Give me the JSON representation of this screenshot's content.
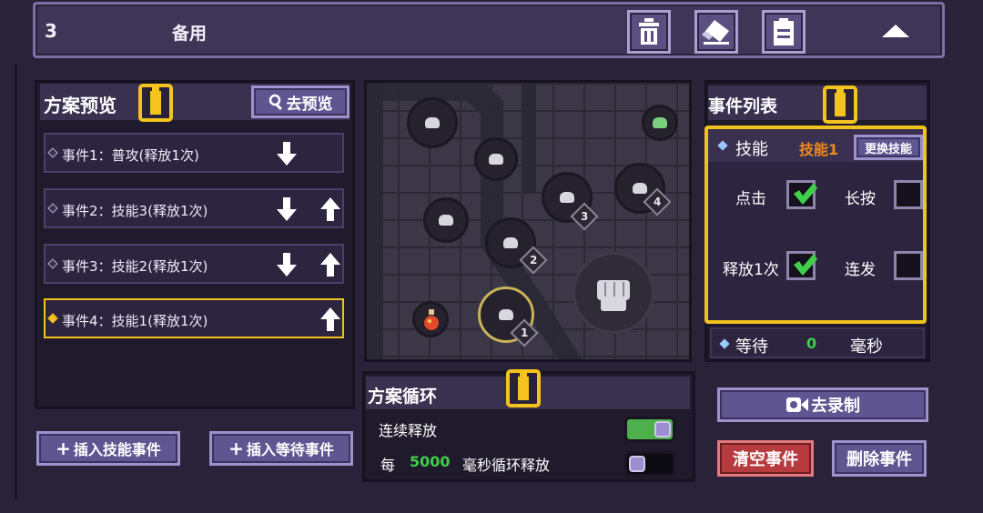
{
  "header": {
    "slot_number": "3",
    "slot_name": "备用"
  },
  "preview": {
    "title": "方案预览",
    "go_preview_label": "去预览",
    "events": [
      {
        "label": "事件1：普攻(释放1次)",
        "down": true,
        "up": false,
        "active": false
      },
      {
        "label": "事件2：技能3(释放1次)",
        "down": true,
        "up": true,
        "active": false
      },
      {
        "label": "事件3：技能2(释放1次)",
        "down": true,
        "up": true,
        "active": false
      },
      {
        "label": "事件4：技能1(释放1次)",
        "down": false,
        "up": true,
        "active": true
      }
    ],
    "insert_skill_label": "插入技能事件",
    "insert_wait_label": "插入等待事件"
  },
  "map": {
    "node_numbers": [
      "1",
      "2",
      "3",
      "4"
    ]
  },
  "loop": {
    "title": "方案循环",
    "continuous_label": "连续释放",
    "continuous_on": true,
    "every_label": "每",
    "interval_value": "5000",
    "interval_suffix": "毫秒循环释放",
    "interval_on": false
  },
  "event_list": {
    "title": "事件列表",
    "type_label": "技能",
    "skill_name": "技能1",
    "change_skill_label": "更换技能",
    "click_label": "点击",
    "click_checked": true,
    "long_press_label": "长按",
    "long_press_checked": false,
    "release_once_label": "释放1次",
    "release_once_checked": true,
    "burst_label": "连发",
    "burst_checked": false,
    "wait_label": "等待",
    "wait_value": "0",
    "wait_unit": "毫秒"
  },
  "actions": {
    "record_label": "去录制",
    "clear_label": "清空事件",
    "delete_label": "删除事件"
  },
  "colors": {
    "accent_yellow": "#f2c21c",
    "button_purple": "#5f5590",
    "button_red": "#b63a3e",
    "value_green": "#3fd04a",
    "skill_orange": "#f08a1e"
  }
}
